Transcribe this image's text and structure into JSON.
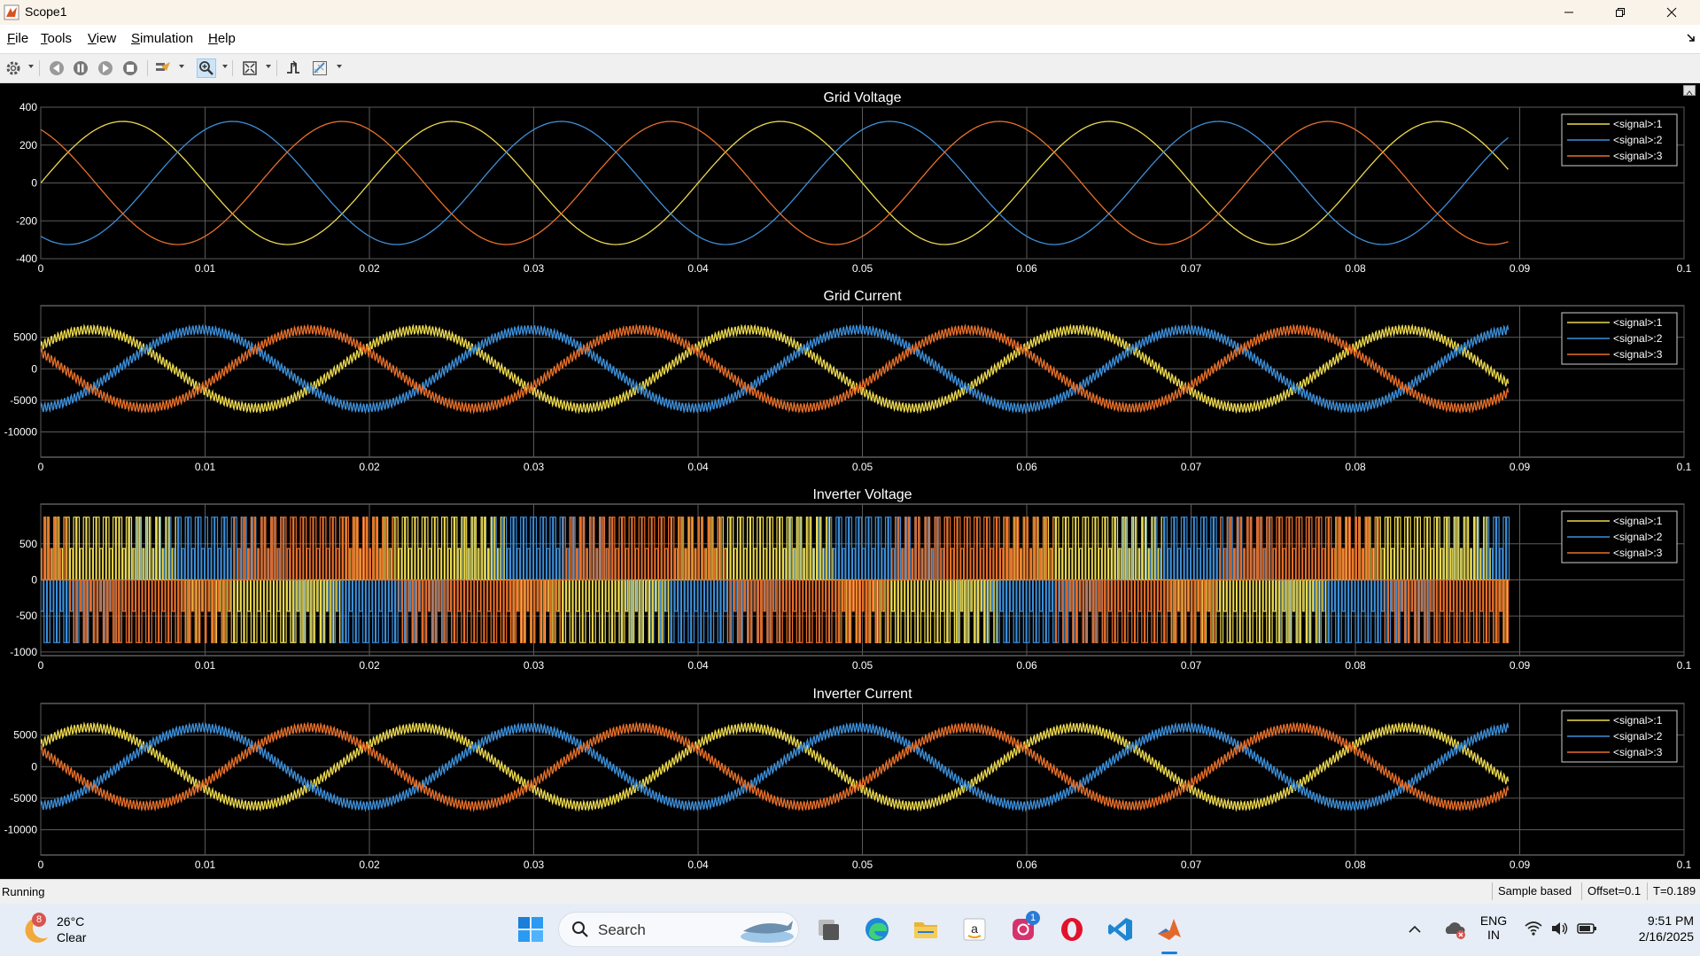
{
  "window": {
    "title": "Scope1",
    "accent": "#0072bd"
  },
  "menu": {
    "items": [
      "File",
      "Tools",
      "View",
      "Simulation",
      "Help"
    ]
  },
  "toolbar": {
    "icons": [
      "gear-icon",
      "step-back-icon",
      "pause-icon",
      "step-forward-icon",
      "stop-icon",
      "highlight-signal-icon",
      "zoom-in-icon",
      "fit-to-view-icon",
      "triggers-icon",
      "measurements-icon"
    ]
  },
  "status": {
    "state": "Running",
    "mode": "Sample based",
    "offset": "Offset=0.1",
    "time": "T=0.189"
  },
  "colors": {
    "signal1": "#edd94f",
    "signal2": "#3d8fd9",
    "signal3": "#e8702a",
    "grid": "#5a5a5a",
    "axis_text": "#ffffff"
  },
  "chart_data": [
    {
      "type": "line",
      "title": "Grid Voltage",
      "xlim": [
        0,
        0.1
      ],
      "ylim": [
        -400,
        400
      ],
      "xticks": [
        "0",
        "0.01",
        "0.02",
        "0.03",
        "0.04",
        "0.05",
        "0.06",
        "0.07",
        "0.08",
        "0.09",
        "0.1"
      ],
      "yticks": [
        "400",
        "200",
        "0",
        "-200",
        "-400"
      ],
      "legend": [
        "<signal>:1",
        "<signal>:2",
        "<signal>:3"
      ],
      "legend_position": "top-right",
      "grid": true,
      "x_end": 0.0893,
      "series": [
        {
          "name": "<signal>:1",
          "amplitude": 325,
          "frequency": 50,
          "phase_deg": 0,
          "ripple": 0
        },
        {
          "name": "<signal>:2",
          "amplitude": 325,
          "frequency": 50,
          "phase_deg": -120,
          "ripple": 0
        },
        {
          "name": "<signal>:3",
          "amplitude": 325,
          "frequency": 50,
          "phase_deg": 120,
          "ripple": 0
        }
      ]
    },
    {
      "type": "line",
      "title": "Grid Current",
      "xlim": [
        0,
        0.1
      ],
      "ylim": [
        -14000,
        10000
      ],
      "xticks": [
        "0",
        "0.01",
        "0.02",
        "0.03",
        "0.04",
        "0.05",
        "0.06",
        "0.07",
        "0.08",
        "0.09",
        "0.1"
      ],
      "yticks": [
        "5000",
        "0",
        "-5000",
        "-10000"
      ],
      "legend": [
        "<signal>:1",
        "<signal>:2",
        "<signal>:3"
      ],
      "legend_position": "top-right",
      "grid": true,
      "x_end": 0.0893,
      "series": [
        {
          "name": "<signal>:1",
          "amplitude": 6200,
          "frequency": 50,
          "phase_deg": 35,
          "ripple": 700
        },
        {
          "name": "<signal>:2",
          "amplitude": 6200,
          "frequency": 50,
          "phase_deg": -85,
          "ripple": 700
        },
        {
          "name": "<signal>:3",
          "amplitude": 6200,
          "frequency": 50,
          "phase_deg": 155,
          "ripple": 700
        }
      ]
    },
    {
      "type": "line",
      "title": "Inverter Voltage",
      "xlim": [
        0,
        0.1
      ],
      "ylim": [
        -1050,
        1050
      ],
      "xticks": [
        "0",
        "0.01",
        "0.02",
        "0.03",
        "0.04",
        "0.05",
        "0.06",
        "0.07",
        "0.08",
        "0.09",
        "0.1"
      ],
      "yticks": [
        "500",
        "0",
        "-500",
        "-1000"
      ],
      "legend": [
        "<signal>:1",
        "<signal>:2",
        "<signal>:3"
      ],
      "legend_position": "top-right",
      "grid": true,
      "x_end": 0.0893,
      "pwm": true,
      "pwm_levels": [
        -870,
        -435,
        0,
        435,
        870
      ],
      "series": [
        {
          "name": "<signal>:1",
          "amplitude": 0.9,
          "frequency": 50,
          "phase_deg": 0,
          "ripple": 0
        },
        {
          "name": "<signal>:2",
          "amplitude": 0.9,
          "frequency": 50,
          "phase_deg": -120,
          "ripple": 0
        },
        {
          "name": "<signal>:3",
          "amplitude": 0.9,
          "frequency": 50,
          "phase_deg": 120,
          "ripple": 0
        }
      ]
    },
    {
      "type": "line",
      "title": "Inverter Current",
      "xlim": [
        0,
        0.1
      ],
      "ylim": [
        -14000,
        10000
      ],
      "xticks": [
        "0",
        "0.01",
        "0.02",
        "0.03",
        "0.04",
        "0.05",
        "0.06",
        "0.07",
        "0.08",
        "0.09",
        "0.1"
      ],
      "yticks": [
        "5000",
        "0",
        "-5000",
        "-10000"
      ],
      "legend": [
        "<signal>:1",
        "<signal>:2",
        "<signal>:3"
      ],
      "legend_position": "top-right",
      "grid": true,
      "x_end": 0.0893,
      "series": [
        {
          "name": "<signal>:1",
          "amplitude": 6200,
          "frequency": 50,
          "phase_deg": 35,
          "ripple": 700
        },
        {
          "name": "<signal>:2",
          "amplitude": 6200,
          "frequency": 50,
          "phase_deg": -85,
          "ripple": 700
        },
        {
          "name": "<signal>:3",
          "amplitude": 6200,
          "frequency": 50,
          "phase_deg": 155,
          "ripple": 700
        }
      ]
    }
  ],
  "taskbar": {
    "weather": {
      "badge": "8",
      "temp": "26°C",
      "condition": "Clear"
    },
    "search_placeholder": "Search",
    "apps": [
      "start-icon",
      "task-view-icon",
      "edge-icon",
      "file-explorer-icon",
      "amazon-icon",
      "instagram-icon",
      "opera-icon",
      "vscode-icon",
      "matlab-icon"
    ],
    "instagram_badge": "1",
    "language": {
      "line1": "ENG",
      "line2": "IN"
    },
    "clock": {
      "time": "9:51 PM",
      "date": "2/16/2025"
    }
  }
}
